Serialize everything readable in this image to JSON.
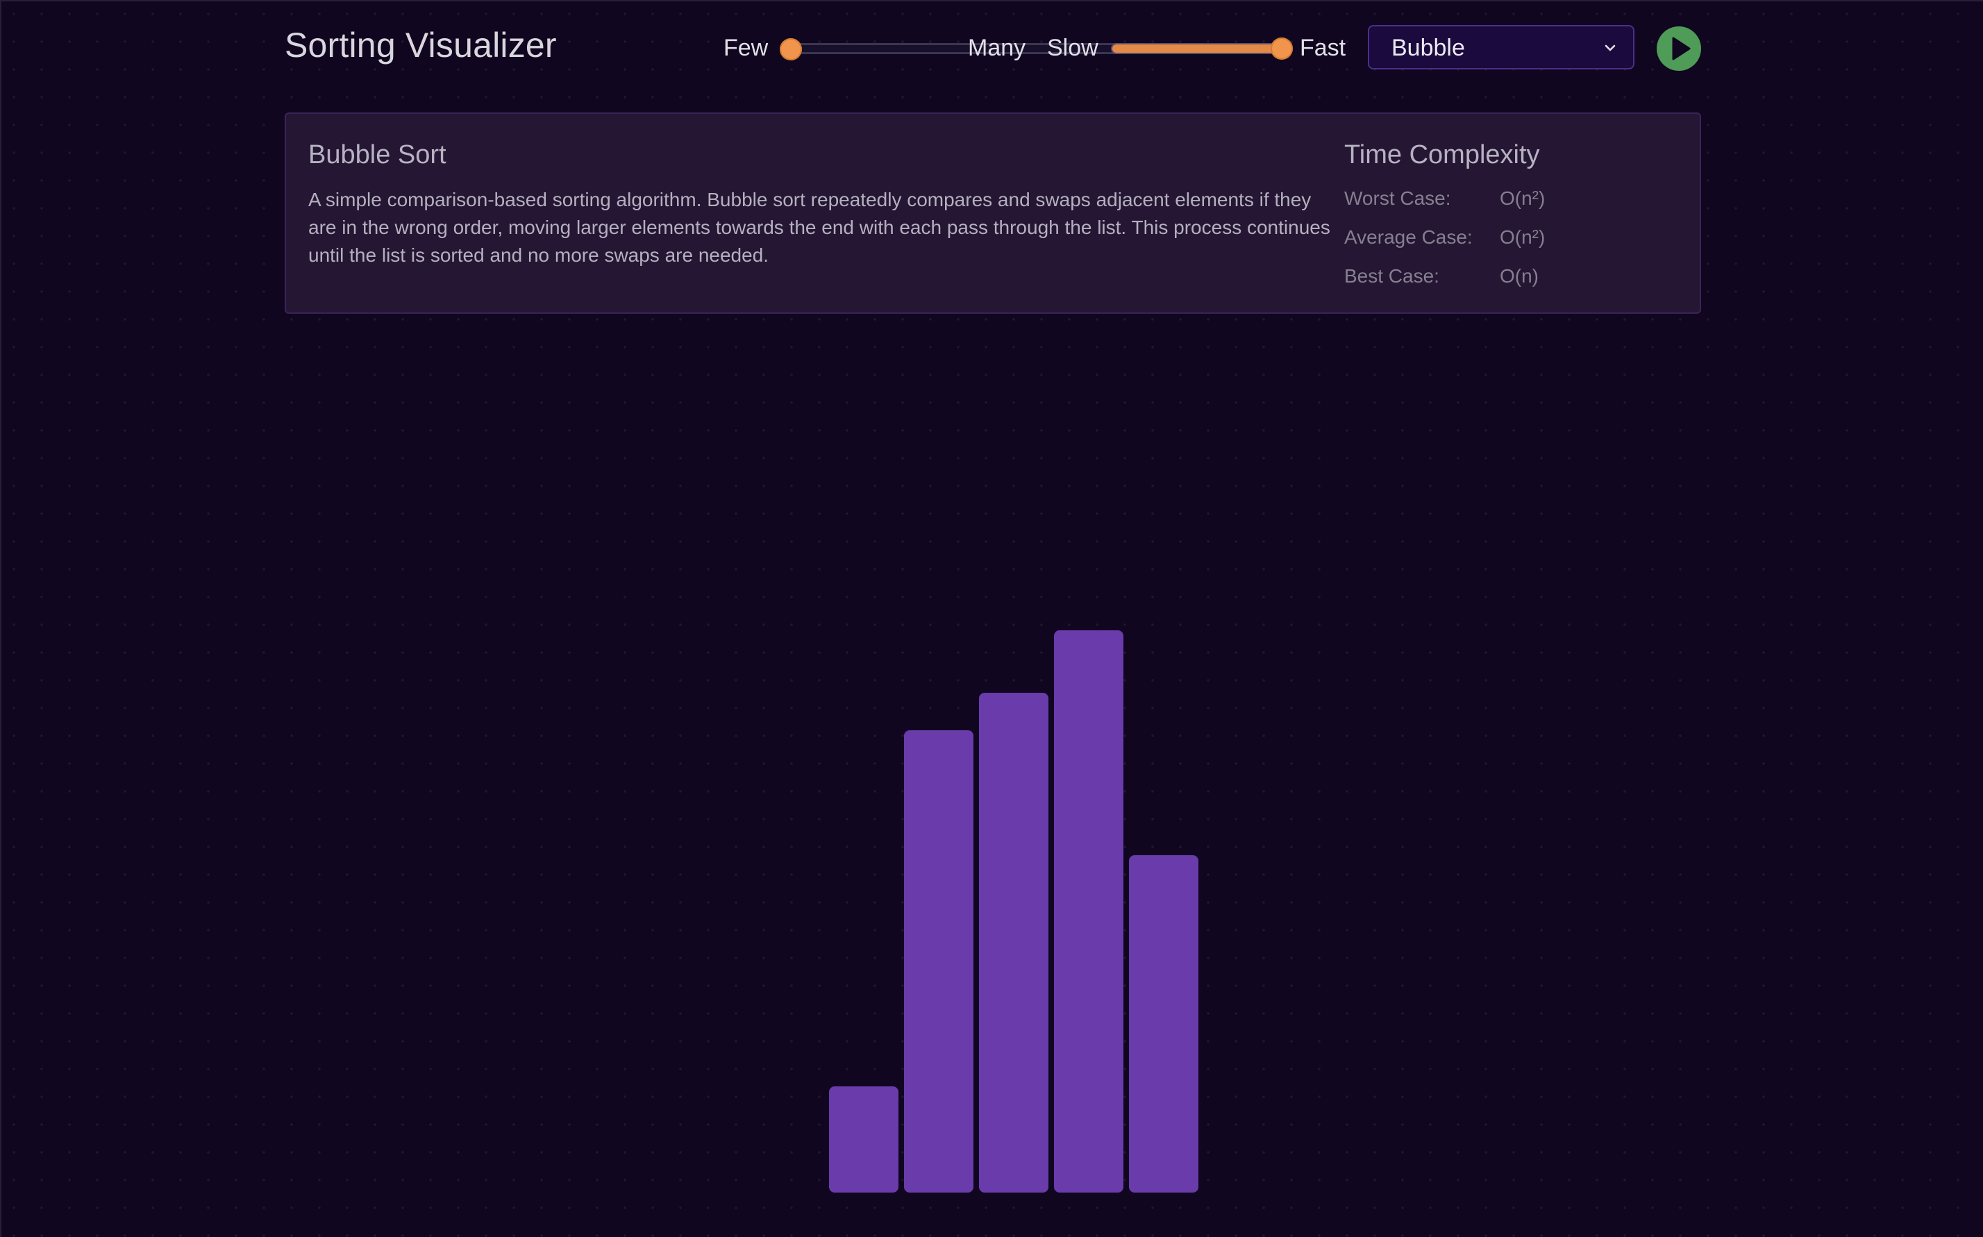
{
  "header": {
    "title": "Sorting Visualizer",
    "size_slider": {
      "label_min": "Few",
      "label_max": "Many",
      "value_fraction": 0.0
    },
    "speed_slider": {
      "label_min": "Slow",
      "label_max": "Fast",
      "value_fraction": 1.0
    },
    "algorithm_select": {
      "value": "Bubble"
    },
    "play_button": {
      "icon": "play-icon"
    }
  },
  "info": {
    "title": "Bubble Sort",
    "description": "A simple comparison-based sorting algorithm. Bubble sort repeatedly compares and swaps adjacent elements if they are in the wrong order, moving larger elements towards the end with each pass through the list. This process continues until the list is sorted and no more swaps are needed.",
    "complexity": {
      "title": "Time Complexity",
      "rows": [
        {
          "label": "Worst Case:",
          "value": "O(n²)"
        },
        {
          "label": "Average Case:",
          "value": "O(n²)"
        },
        {
          "label": "Best Case:",
          "value": "O(n)"
        }
      ]
    }
  },
  "colors": {
    "background": "#10061f",
    "bar": "#6a3bab",
    "accent_orange": "#f0954b",
    "play_green": "#4f9b58"
  },
  "chart_data": {
    "type": "bar",
    "values": [
      17,
      74,
      80,
      90,
      54
    ]
  }
}
